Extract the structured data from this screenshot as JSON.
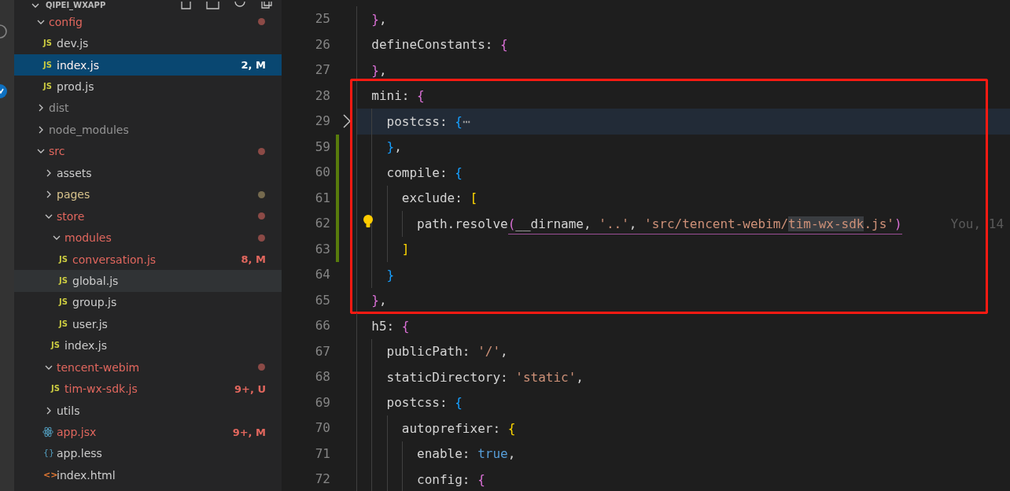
{
  "explorer": {
    "title": "QIPEI_WXAPP",
    "tree": [
      {
        "kind": "folder",
        "name": "config",
        "expanded": true,
        "modified": true,
        "ignored": false,
        "warning": false,
        "color": "#8c4a46",
        "selected": false,
        "hovered": false,
        "children": [
          {
            "kind": "js",
            "icon": "JS",
            "name": "dev.js",
            "modified": false,
            "ignored": false,
            "warning": false,
            "selected": false,
            "hovered": false
          },
          {
            "kind": "js",
            "icon": "JS",
            "name": "index.js",
            "modified": true,
            "ignored": false,
            "warning": false,
            "badge": "2, M",
            "selected": true,
            "hovered": false
          },
          {
            "kind": "js",
            "icon": "JS",
            "name": "prod.js",
            "modified": false,
            "ignored": false,
            "warning": false,
            "selected": false,
            "hovered": false
          }
        ]
      },
      {
        "kind": "folder",
        "name": "dist",
        "expanded": false,
        "modified": false,
        "ignored": true,
        "warning": false,
        "selected": false,
        "hovered": false
      },
      {
        "kind": "folder",
        "name": "node_modules",
        "expanded": false,
        "modified": false,
        "ignored": true,
        "warning": false,
        "selected": false,
        "hovered": false
      },
      {
        "kind": "folder",
        "name": "src",
        "expanded": true,
        "modified": true,
        "ignored": false,
        "warning": false,
        "color": "#8c4a46",
        "selected": false,
        "hovered": false,
        "children": [
          {
            "kind": "folder",
            "name": "assets",
            "expanded": false,
            "modified": false,
            "ignored": false,
            "warning": false,
            "selected": false,
            "hovered": false
          },
          {
            "kind": "folder",
            "name": "pages",
            "expanded": false,
            "modified": false,
            "ignored": false,
            "warning": true,
            "color": "#756a4e",
            "selected": false,
            "hovered": false
          },
          {
            "kind": "folder",
            "name": "store",
            "expanded": true,
            "modified": true,
            "ignored": false,
            "warning": false,
            "color": "#8c4a46",
            "selected": false,
            "hovered": false,
            "children": [
              {
                "kind": "folder",
                "name": "modules",
                "expanded": true,
                "modified": true,
                "ignored": false,
                "warning": false,
                "color": "#8c4a46",
                "selected": false,
                "hovered": false,
                "children": [
                  {
                    "kind": "js",
                    "icon": "JS",
                    "name": "conversation.js",
                    "modified": true,
                    "ignored": false,
                    "warning": false,
                    "badge": "8, M",
                    "selected": false,
                    "hovered": false
                  },
                  {
                    "kind": "js",
                    "icon": "JS",
                    "name": "global.js",
                    "modified": false,
                    "ignored": false,
                    "warning": false,
                    "selected": false,
                    "hovered": true
                  },
                  {
                    "kind": "js",
                    "icon": "JS",
                    "name": "group.js",
                    "modified": false,
                    "ignored": false,
                    "warning": false,
                    "selected": false,
                    "hovered": false
                  },
                  {
                    "kind": "js",
                    "icon": "JS",
                    "name": "user.js",
                    "modified": false,
                    "ignored": false,
                    "warning": false,
                    "selected": false,
                    "hovered": false
                  }
                ]
              },
              {
                "kind": "js",
                "icon": "JS",
                "name": "index.js",
                "modified": false,
                "ignored": false,
                "warning": false,
                "selected": false,
                "hovered": false
              }
            ]
          },
          {
            "kind": "folder",
            "name": "tencent-webim",
            "expanded": true,
            "modified": true,
            "ignored": false,
            "warning": false,
            "color": "#8c4a46",
            "selected": false,
            "hovered": false,
            "children": [
              {
                "kind": "js",
                "icon": "JS",
                "name": "tim-wx-sdk.js",
                "modified": true,
                "ignored": false,
                "warning": false,
                "badge": "9+, U",
                "selected": false,
                "hovered": false
              }
            ]
          },
          {
            "kind": "folder",
            "name": "utils",
            "expanded": false,
            "modified": false,
            "ignored": false,
            "warning": false,
            "selected": false,
            "hovered": false
          },
          {
            "kind": "react",
            "name": "app.jsx",
            "modified": true,
            "ignored": false,
            "warning": false,
            "badge": "9+, M",
            "selected": false,
            "hovered": false
          },
          {
            "kind": "less",
            "icon": "{}",
            "name": "app.less",
            "modified": false,
            "ignored": false,
            "warning": false,
            "selected": false,
            "hovered": false
          },
          {
            "kind": "html",
            "icon": "<>",
            "name": "index.html",
            "modified": false,
            "ignored": false,
            "warning": false,
            "selected": false,
            "hovered": false
          }
        ]
      }
    ]
  },
  "editor": {
    "lines": [
      {
        "number": "25",
        "boxed": false,
        "current": false,
        "folded": false,
        "changed": false,
        "tokens": [
          {
            "text": "  }",
            "kind": "b2"
          },
          {
            "text": ","
          }
        ]
      },
      {
        "number": "26",
        "boxed": false,
        "current": false,
        "folded": false,
        "changed": false,
        "tokens": [
          {
            "text": "  defineConstants: "
          },
          {
            "text": "{",
            "kind": "b2"
          }
        ]
      },
      {
        "number": "27",
        "boxed": false,
        "current": false,
        "folded": false,
        "changed": false,
        "tokens": [
          {
            "text": "  }",
            "kind": "b2"
          },
          {
            "text": ","
          }
        ]
      },
      {
        "number": "28",
        "boxed": true,
        "current": false,
        "folded": false,
        "changed": false,
        "tokens": [
          {
            "text": "  mini: "
          },
          {
            "text": "{",
            "kind": "b2"
          }
        ]
      },
      {
        "number": "29",
        "boxed": true,
        "current": true,
        "folded": true,
        "changed": false,
        "tokens": [
          {
            "text": "    postcss: "
          },
          {
            "text": "{",
            "kind": "b3"
          },
          {
            "text": "⋯",
            "kind": "fold"
          }
        ]
      },
      {
        "number": "59",
        "boxed": true,
        "current": false,
        "folded": false,
        "changed": true,
        "tokens": [
          {
            "text": "    }",
            "kind": "b3"
          },
          {
            "text": ","
          }
        ]
      },
      {
        "number": "60",
        "boxed": true,
        "current": false,
        "folded": false,
        "changed": true,
        "tokens": [
          {
            "text": "    compile: "
          },
          {
            "text": "{",
            "kind": "b3"
          }
        ]
      },
      {
        "number": "61",
        "boxed": true,
        "current": false,
        "folded": false,
        "changed": true,
        "tokens": [
          {
            "text": "      exclude: "
          },
          {
            "text": "[",
            "kind": "b1"
          }
        ]
      },
      {
        "number": "62",
        "boxed": true,
        "current": false,
        "folded": false,
        "changed": true,
        "hint": true,
        "blame": "You, 14",
        "tokens": [
          {
            "text": "        path.resolve"
          },
          {
            "kind": "group",
            "underlined": true,
            "parts": [
              {
                "text": "(",
                "kind": "b2"
              },
              {
                "text": "__dirname, "
              },
              {
                "text": "'..'",
                "kind": "string"
              },
              {
                "text": ", "
              },
              {
                "text": "'src/tencent-webim/",
                "kind": "string"
              },
              {
                "text": "tim-wx-sdk",
                "kind": "string",
                "highlighted": true
              },
              {
                "text": ".js'",
                "kind": "string"
              },
              {
                "text": ")",
                "kind": "b2"
              }
            ]
          }
        ]
      },
      {
        "number": "63",
        "boxed": true,
        "current": false,
        "folded": false,
        "changed": true,
        "tokens": [
          {
            "text": "      ]",
            "kind": "b1"
          }
        ]
      },
      {
        "number": "64",
        "boxed": true,
        "current": false,
        "folded": false,
        "changed": false,
        "tokens": [
          {
            "text": "    }",
            "kind": "b3"
          }
        ]
      },
      {
        "number": "65",
        "boxed": true,
        "current": false,
        "folded": false,
        "changed": false,
        "tokens": [
          {
            "text": "  }",
            "kind": "b2"
          },
          {
            "text": ","
          }
        ]
      },
      {
        "number": "66",
        "boxed": false,
        "current": false,
        "folded": false,
        "changed": false,
        "tokens": [
          {
            "text": "  h5: "
          },
          {
            "text": "{",
            "kind": "b2"
          }
        ]
      },
      {
        "number": "67",
        "boxed": false,
        "current": false,
        "folded": false,
        "changed": false,
        "tokens": [
          {
            "text": "    publicPath: "
          },
          {
            "text": "'/'",
            "kind": "string"
          },
          {
            "text": ","
          }
        ]
      },
      {
        "number": "68",
        "boxed": false,
        "current": false,
        "folded": false,
        "changed": false,
        "tokens": [
          {
            "text": "    staticDirectory: "
          },
          {
            "text": "'static'",
            "kind": "string"
          },
          {
            "text": ","
          }
        ]
      },
      {
        "number": "69",
        "boxed": false,
        "current": false,
        "folded": false,
        "changed": false,
        "tokens": [
          {
            "text": "    postcss: "
          },
          {
            "text": "{",
            "kind": "b3"
          }
        ]
      },
      {
        "number": "70",
        "boxed": false,
        "current": false,
        "folded": false,
        "changed": false,
        "tokens": [
          {
            "text": "      autoprefixer: "
          },
          {
            "text": "{",
            "kind": "b1"
          }
        ]
      },
      {
        "number": "71",
        "boxed": false,
        "current": false,
        "folded": false,
        "changed": false,
        "tokens": [
          {
            "text": "        enable: "
          },
          {
            "text": "true",
            "kind": "keyword"
          },
          {
            "text": ","
          }
        ]
      },
      {
        "number": "72",
        "boxed": false,
        "current": false,
        "folded": false,
        "changed": false,
        "tokens": [
          {
            "text": "        config: "
          },
          {
            "text": "{",
            "kind": "b2"
          }
        ]
      }
    ]
  }
}
